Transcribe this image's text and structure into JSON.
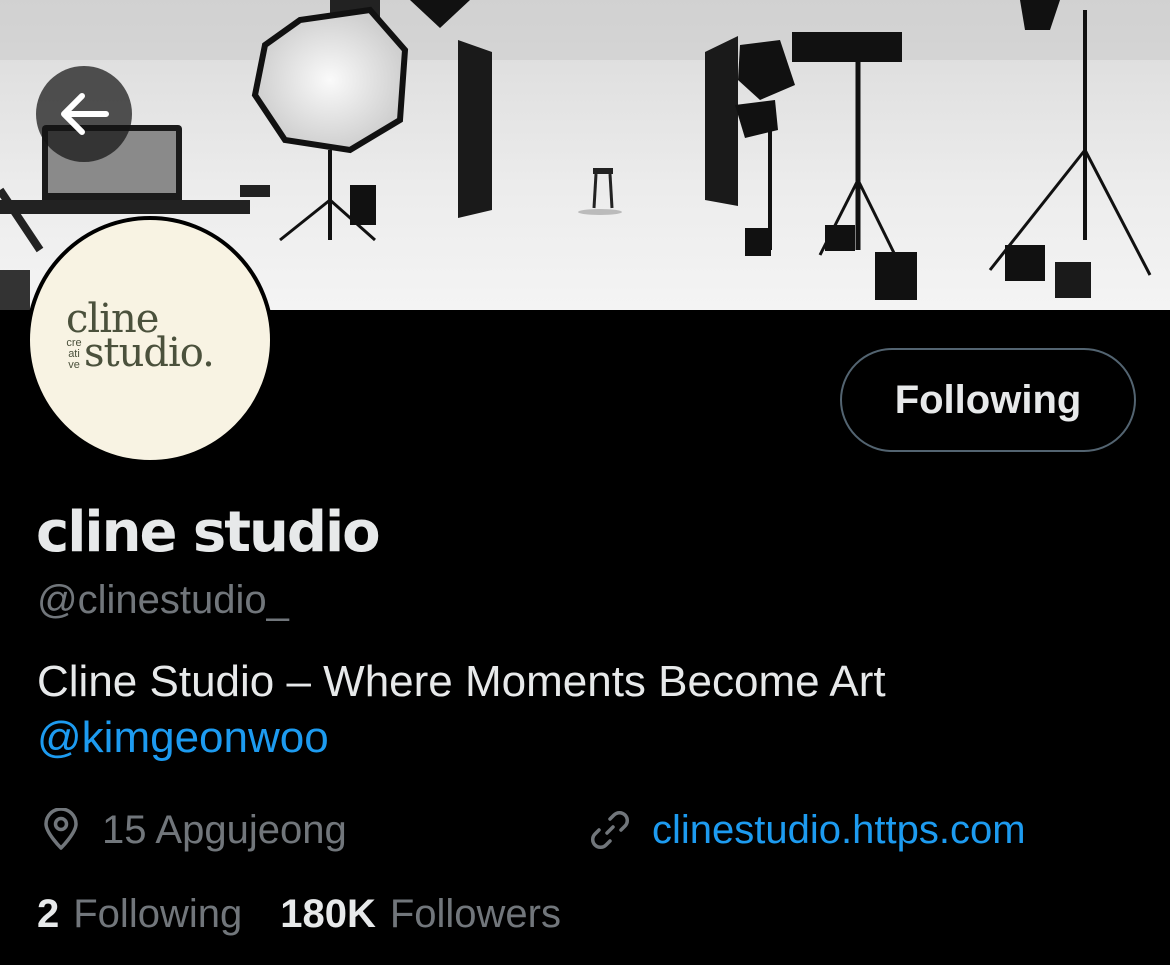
{
  "header": {
    "back_icon": "arrow-left-icon"
  },
  "profile": {
    "avatar_logo": {
      "line1": "cline",
      "small": [
        "cre",
        "ati",
        "ve"
      ],
      "line2": "studio."
    },
    "follow_button_label": "Following",
    "display_name": "cline studio",
    "handle": "@clinestudio_",
    "bio_text": "Cline Studio – Where Moments Become Art",
    "bio_mention": "@kimgeonwoo",
    "location_icon": "location-pin-icon",
    "location": "15 Apgujeong",
    "link_icon": "link-icon",
    "website": "clinestudio.https.com",
    "following_count": "2",
    "following_label": "Following",
    "followers_count": "180K",
    "followers_label": "Followers"
  },
  "colors": {
    "background": "#000000",
    "accent": "#1d9bf0",
    "secondary_text": "#71767b",
    "primary_text": "#e7e9ea",
    "avatar_bg": "#f8f3e3",
    "logo_color": "#4b513c"
  }
}
